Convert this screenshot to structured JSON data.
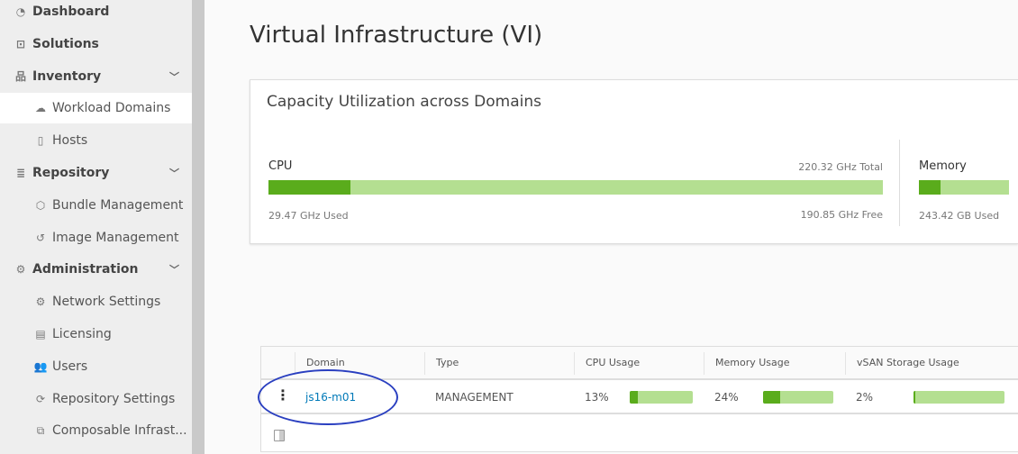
{
  "sidebar": {
    "items": [
      {
        "label": "Dashboard",
        "icon": "dashboard-icon",
        "level": "top"
      },
      {
        "label": "Solutions",
        "icon": "solutions-icon",
        "level": "top"
      },
      {
        "label": "Inventory",
        "icon": "inventory-icon",
        "level": "top",
        "expanded": true
      },
      {
        "label": "Workload Domains",
        "icon": "cloud-icon",
        "level": "sub",
        "active": true
      },
      {
        "label": "Hosts",
        "icon": "host-icon",
        "level": "sub"
      },
      {
        "label": "Repository",
        "icon": "database-icon",
        "level": "top",
        "expanded": true
      },
      {
        "label": "Bundle Management",
        "icon": "box-icon",
        "level": "sub"
      },
      {
        "label": "Image Management",
        "icon": "history-icon",
        "level": "sub"
      },
      {
        "label": "Administration",
        "icon": "gear-icon",
        "level": "top",
        "expanded": true
      },
      {
        "label": "Network Settings",
        "icon": "network-settings-icon",
        "level": "sub"
      },
      {
        "label": "Licensing",
        "icon": "license-icon",
        "level": "sub"
      },
      {
        "label": "Users",
        "icon": "users-icon",
        "level": "sub"
      },
      {
        "label": "Repository Settings",
        "icon": "sync-icon",
        "level": "sub"
      },
      {
        "label": "Composable Infrast...",
        "icon": "composable-icon",
        "level": "sub"
      }
    ]
  },
  "page": {
    "title": "Virtual Infrastructure (VI)"
  },
  "capacity": {
    "title": "Capacity Utilization across Domains",
    "cpu": {
      "label": "CPU",
      "total": "220.32 GHz Total",
      "used": "29.47 GHz Used",
      "free": "190.85 GHz Free",
      "percent": 13.4
    },
    "memory": {
      "label": "Memory",
      "used": "243.42 GB Used",
      "percent": 24
    }
  },
  "table": {
    "headers": [
      "Domain",
      "Type",
      "CPU Usage",
      "Memory Usage",
      "vSAN Storage Usage"
    ],
    "rows": [
      {
        "domain": "js16-m01",
        "type": "MANAGEMENT",
        "cpu": "13%",
        "cpu_pct": 13,
        "memory": "24%",
        "memory_pct": 24,
        "vsan": "2%",
        "vsan_pct": 2
      }
    ]
  },
  "colors": {
    "accent": "#5aac1c",
    "bar_bg": "#b4df91",
    "link": "#0079b8",
    "annotation": "#2a3fc0"
  }
}
